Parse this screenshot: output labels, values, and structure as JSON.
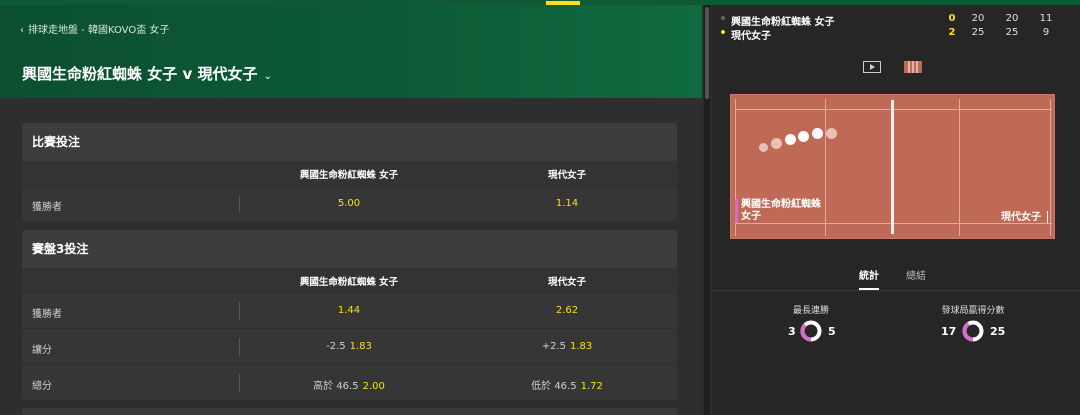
{
  "breadcrumb": "排球走地盤 - 韓國KOVO盃 女子",
  "match_title": "興國生命粉紅蜘蛛 女子 v 現代女子",
  "cards": [
    {
      "title": "比賽投注",
      "col1": "興國生命粉紅蜘蛛 女子",
      "col2": "現代女子",
      "rows": [
        {
          "label": "獲勝者",
          "c1_handicap": "",
          "c1_odds": "5.00",
          "c2_handicap": "",
          "c2_odds": "1.14"
        }
      ]
    },
    {
      "title": "賽盤3投注",
      "col1": "興國生命粉紅蜘蛛 女子",
      "col2": "現代女子",
      "rows": [
        {
          "label": "獲勝者",
          "c1_handicap": "",
          "c1_odds": "1.44",
          "c2_handicap": "",
          "c2_odds": "2.62"
        },
        {
          "label": "讓分",
          "c1_handicap": "-2.5",
          "c1_odds": "1.83",
          "c2_handicap": "+2.5",
          "c2_odds": "1.83"
        },
        {
          "label": "總分",
          "c1_handicap": "高於 46.5",
          "c1_odds": "2.00",
          "c2_handicap": "低於 46.5",
          "c2_odds": "1.72"
        }
      ]
    }
  ],
  "scoreboard": {
    "teams": [
      {
        "name": "興國生命粉紅蜘蛛 女子",
        "sets": "0",
        "scores": [
          "20",
          "20",
          "11"
        ],
        "serving": false
      },
      {
        "name": "現代女子",
        "sets": "2",
        "scores": [
          "25",
          "25",
          "9"
        ],
        "serving": true
      }
    ]
  },
  "court": {
    "home_name_line1": "興國生命粉紅蜘蛛",
    "home_name_line2": "女子",
    "away_name": "現代女子"
  },
  "tabs": [
    {
      "label": "統計",
      "active": true
    },
    {
      "label": "總結",
      "active": false
    }
  ],
  "stats": {
    "longest_streak": {
      "label": "最長連勝",
      "home": "3",
      "away": "5"
    },
    "serve_points": {
      "label": "發球局贏得分數",
      "home": "17",
      "away": "25"
    }
  },
  "colors": {
    "accent": "#ffdf1b",
    "header_green": "#0d5a36",
    "court": "#bf6a57",
    "home_team": "#d46ec9"
  },
  "icons": [
    "play-icon",
    "court-view-icon"
  ]
}
